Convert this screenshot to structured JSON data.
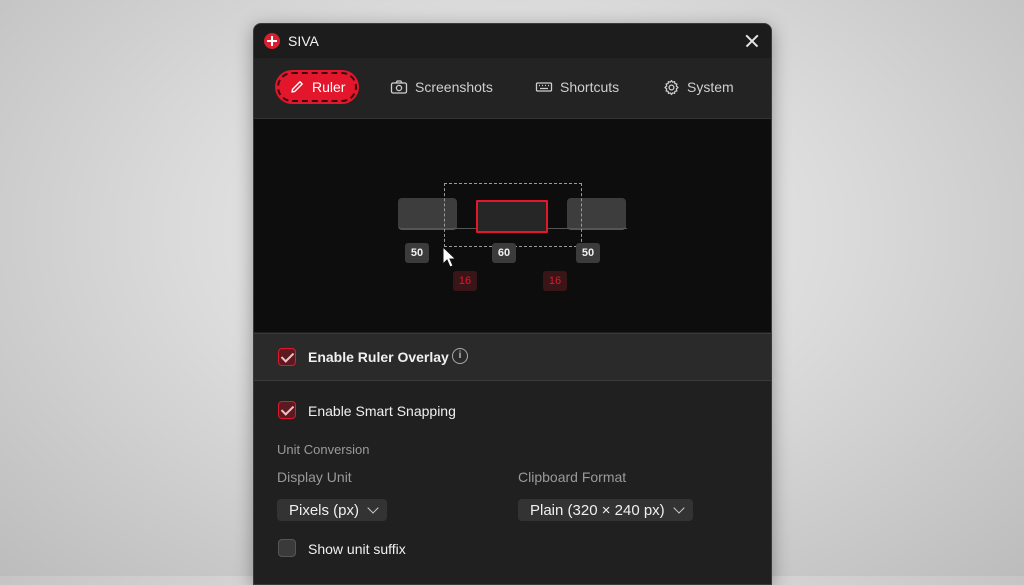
{
  "window": {
    "title": "SIVA"
  },
  "tabs": [
    {
      "label": "Ruler",
      "icon": "pencil-icon",
      "active": true
    },
    {
      "label": "Screenshots",
      "icon": "camera-icon",
      "active": false
    },
    {
      "label": "Shortcuts",
      "icon": "keyboard-icon",
      "active": false
    },
    {
      "label": "System",
      "icon": "gear-icon",
      "active": false
    }
  ],
  "preview": {
    "measure_left": "50",
    "measure_center": "60",
    "measure_right": "50",
    "gap_left": "16",
    "gap_right": "16"
  },
  "settings": {
    "enable_ruler_overlay": {
      "label": "Enable Ruler Overlay",
      "checked": true
    },
    "enable_smart_snapping": {
      "label": "Enable Smart Snapping",
      "checked": true
    },
    "unit_conversion_title": "Unit Conversion",
    "display_unit": {
      "label": "Display Unit",
      "value": "Pixels (px)"
    },
    "clipboard_format": {
      "label": "Clipboard Format",
      "value": "Plain (320 × 240 px)"
    },
    "show_unit_suffix": {
      "label": "Show unit suffix",
      "checked": false
    }
  },
  "colors": {
    "accent": "#e3162b",
    "background": "#202020",
    "preview_bg": "#0d0d0d"
  }
}
